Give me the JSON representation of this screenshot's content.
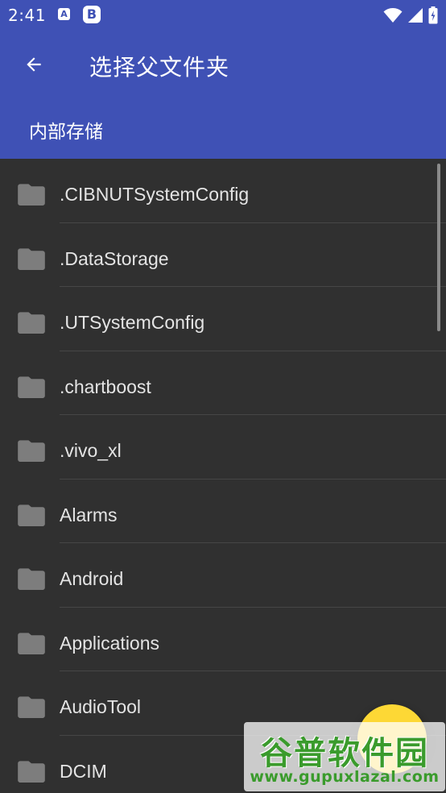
{
  "status_bar": {
    "time": "2:41",
    "notification_icons": [
      "A",
      "B"
    ],
    "icons": [
      "wifi-icon",
      "signal-icon",
      "battery-icon"
    ]
  },
  "app_bar": {
    "title": "选择父文件夹",
    "path": "内部存储",
    "back_icon": "arrow-left-icon"
  },
  "folders": [
    {
      "name": ".CIBNUTSystemConfig"
    },
    {
      "name": ".DataStorage"
    },
    {
      "name": ".UTSystemConfig"
    },
    {
      "name": ".chartboost"
    },
    {
      "name": ".vivo_xl"
    },
    {
      "name": "Alarms"
    },
    {
      "name": "Android"
    },
    {
      "name": "Applications"
    },
    {
      "name": "AudioTool"
    },
    {
      "name": "DCIM"
    }
  ],
  "fab": {
    "color": "#fdd835"
  },
  "watermark": {
    "title": "谷普软件园",
    "url": "www.gupuxlazal.com"
  },
  "colors": {
    "primary": "#3f51b5",
    "background": "#303030",
    "folder_icon": "#bdbdbd",
    "text": "#e4e4e4",
    "accent": "#fdd835"
  }
}
